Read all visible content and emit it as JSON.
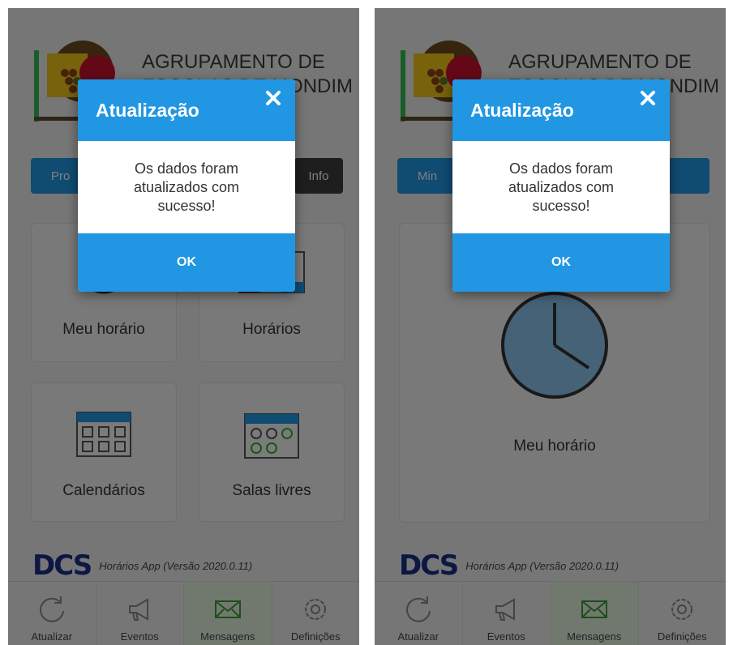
{
  "colors": {
    "accent": "#2196e3",
    "info_tab": "#3d3d3d",
    "brand_dcs": "#1b2f86",
    "active_nav": "#e3f3df"
  },
  "screens": [
    {
      "school_title_line1": "AGRUPAMENTO DE",
      "school_title_line2": "ESCOLAS DE MONDIM",
      "tabs": [
        "Pro",
        "Info"
      ],
      "tiles": [
        "Meu horário",
        "Horários",
        "Calendários",
        "Salas livres"
      ],
      "brand": "DCS",
      "version": "Horários App (Versão 2020.0.11)",
      "nav": [
        "Atualizar",
        "Eventos",
        "Mensagens",
        "Definições"
      ],
      "dialog": {
        "title": "Atualização",
        "message": "Os dados foram atualizados com sucesso!",
        "ok": "OK"
      }
    },
    {
      "school_title_line1": "AGRUPAMENTO DE",
      "school_title_line2": "ESCOLAS DE MONDIM",
      "tabs": [
        "Min"
      ],
      "tiles": [
        "Meu horário"
      ],
      "brand": "DCS",
      "version": "Horários App (Versão 2020.0.11)",
      "nav": [
        "Atualizar",
        "Eventos",
        "Mensagens",
        "Definições"
      ],
      "dialog": {
        "title": "Atualização",
        "message": "Os dados foram atualizados com sucesso!",
        "ok": "OK"
      }
    }
  ]
}
